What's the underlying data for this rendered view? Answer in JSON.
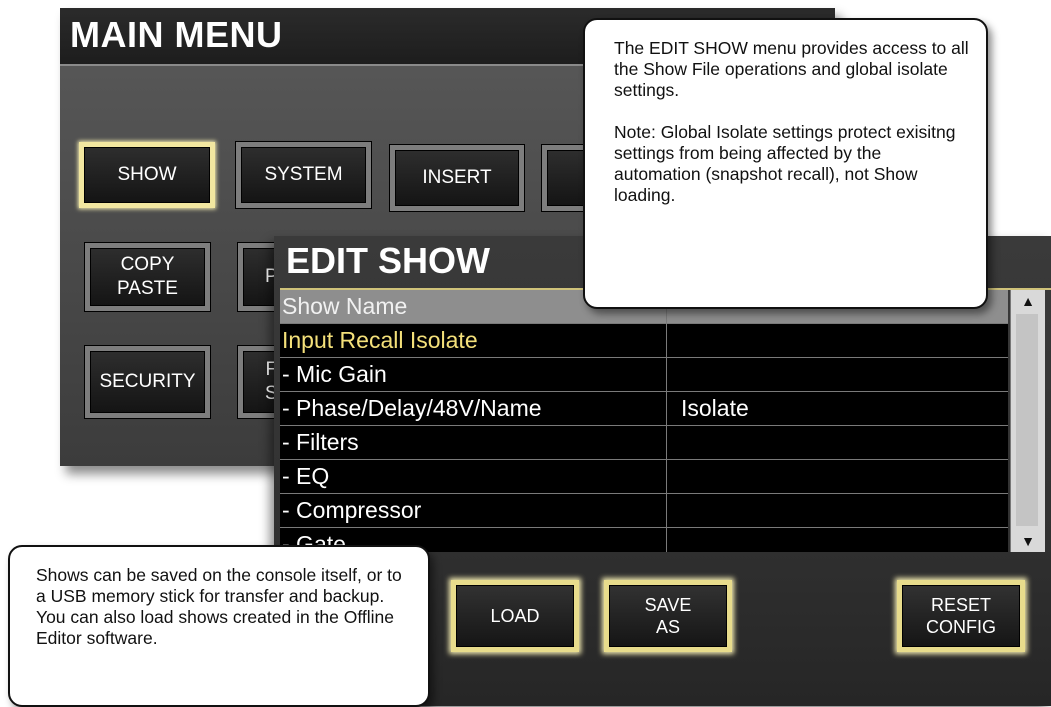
{
  "main_menu": {
    "title": "MAIN MENU",
    "buttons": {
      "show": "SHOW",
      "system": "SYSTEM",
      "insert": "INSERT",
      "copy_paste": "COPY\nPASTE",
      "security": "SECURITY",
      "partial_row2": "P",
      "partial_row3": "F\nS"
    }
  },
  "edit_show": {
    "title": "EDIT SHOW",
    "rows": [
      {
        "label": "Show Name",
        "value": ""
      },
      {
        "label": "Input Recall Isolate",
        "value": ""
      },
      {
        "label": "- Mic Gain",
        "value": ""
      },
      {
        "label": "- Phase/Delay/48V/Name",
        "value": "Isolate"
      },
      {
        "label": "- Filters",
        "value": ""
      },
      {
        "label": "- EQ",
        "value": ""
      },
      {
        "label": "- Compressor",
        "value": ""
      },
      {
        "label": "- Gate",
        "value": ""
      }
    ],
    "buttons": {
      "load": "LOAD",
      "save_as": "SAVE\nAS",
      "reset_config": "RESET\nCONFIG"
    },
    "scroll_up_glyph": "▲",
    "scroll_down_glyph": "▼"
  },
  "callouts": {
    "top_paragraph_1": "The EDIT SHOW menu provides access to all the Show File operations and global isolate settings.",
    "top_paragraph_2": "Note: Global Isolate settings protect exisitng settings from being affected by the automation (snapshot recall), not Show loading.",
    "bottom": "Shows can be saved on the console itself, or to a USB memory stick for transfer and backup. You can also load shows created in the Offline Editor software."
  },
  "colors": {
    "selected_border": "#f2e7a0",
    "section_text": "#f4e07a",
    "panel_bg": "#4e4e4e"
  }
}
